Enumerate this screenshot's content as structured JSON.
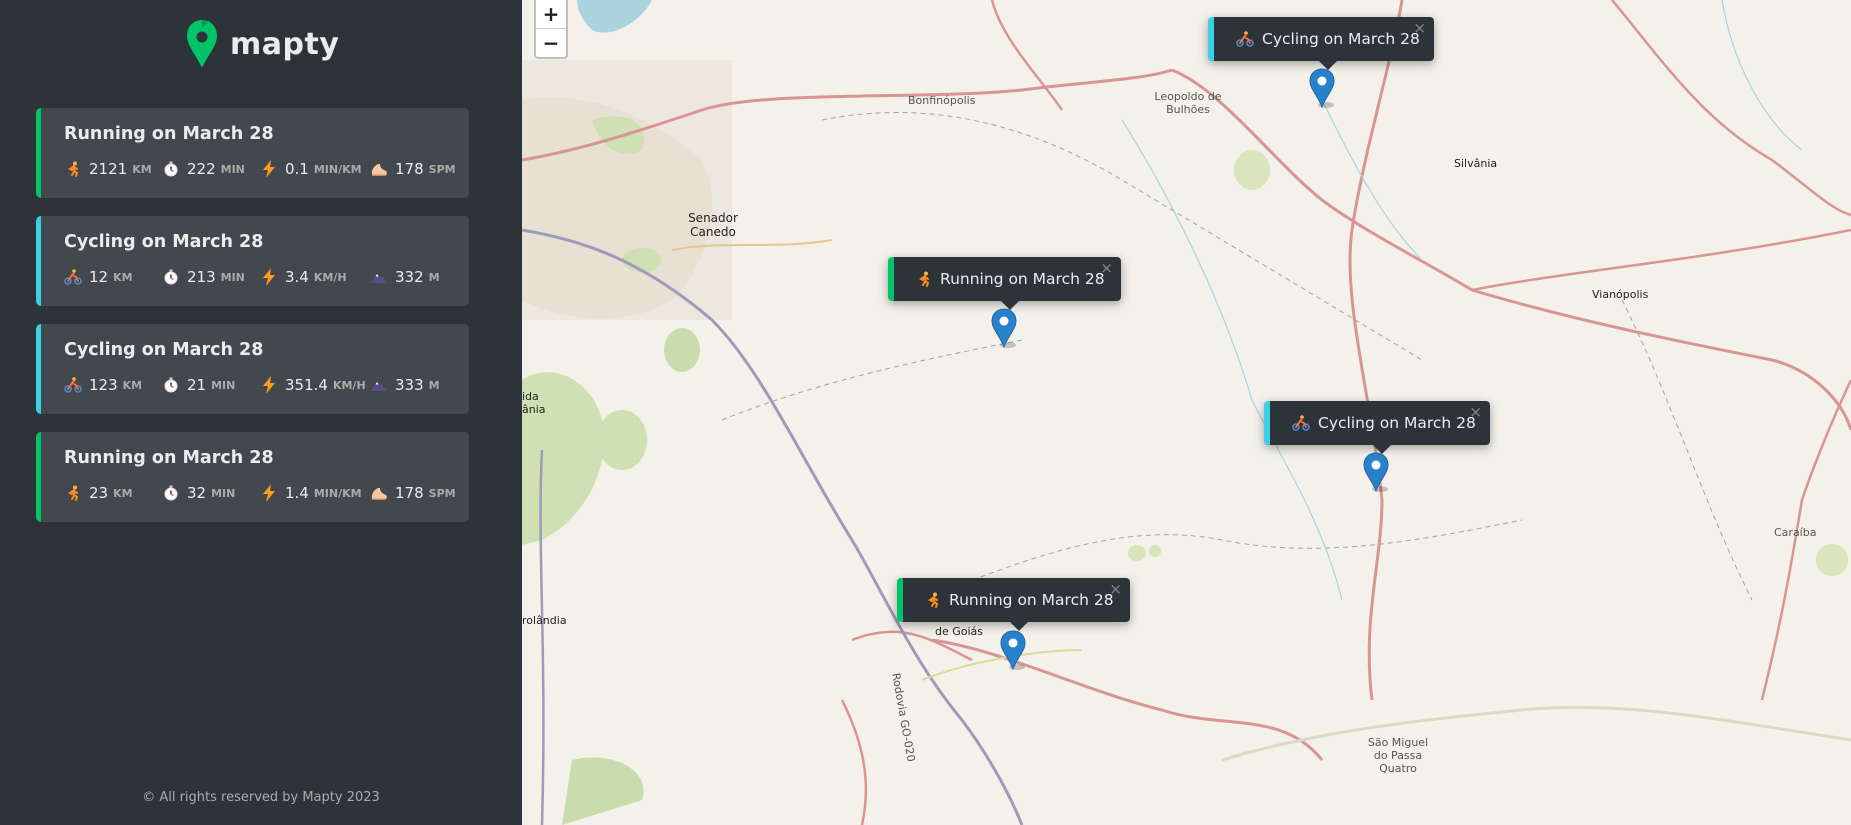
{
  "app": {
    "name": "mapty"
  },
  "footer": "© All rights reserved by Mapty 2023",
  "zoom": {
    "in": "+",
    "out": "−"
  },
  "workouts": [
    {
      "type": "running",
      "title": "Running on March 28",
      "distance": "2121",
      "distance_unit": "KM",
      "duration": "222",
      "duration_unit": "MIN",
      "speed": "0.1",
      "speed_unit": "MIN/KM",
      "extra": "178",
      "extra_unit": "SPM"
    },
    {
      "type": "cycling",
      "title": "Cycling on March 28",
      "distance": "12",
      "distance_unit": "KM",
      "duration": "213",
      "duration_unit": "MIN",
      "speed": "3.4",
      "speed_unit": "KM/H",
      "extra": "332",
      "extra_unit": "M"
    },
    {
      "type": "cycling",
      "title": "Cycling on March 28",
      "distance": "123",
      "distance_unit": "KM",
      "duration": "21",
      "duration_unit": "MIN",
      "speed": "351.4",
      "speed_unit": "KM/H",
      "extra": "333",
      "extra_unit": "M"
    },
    {
      "type": "running",
      "title": "Running on March 28",
      "distance": "23",
      "distance_unit": "KM",
      "duration": "32",
      "duration_unit": "MIN",
      "speed": "1.4",
      "speed_unit": "MIN/KM",
      "extra": "178",
      "extra_unit": "SPM"
    }
  ],
  "popups": [
    {
      "type": "cycling",
      "label": "Cycling on March 28",
      "close": "×"
    },
    {
      "type": "running",
      "label": "Running on March 28",
      "close": "×"
    },
    {
      "type": "cycling",
      "label": "Cycling on March 28",
      "close": "×"
    },
    {
      "type": "running",
      "label": "Running on March 28",
      "close": "×"
    }
  ],
  "map_labels": [
    "Bonfinópolis",
    "Leopoldo de Bulhões",
    "Silvânia",
    "Senador Canedo",
    "Vianópolis",
    "Caraíba",
    "de Goiás",
    "Rodovia GO-020",
    "São Miguel do Passa Quatro",
    "rolândia",
    "ida ânia"
  ],
  "colors": {
    "running": "#00c46a",
    "cycling": "#3ad1e6",
    "sidebar": "#2d3439",
    "card": "#42484d",
    "marker": "#2a81cb"
  },
  "icons": {
    "running": "running-person-icon",
    "cycling": "cyclist-icon",
    "duration": "stopwatch-icon",
    "speed": "lightning-icon",
    "cadence": "footprint-icon",
    "elevation": "mountain-icon"
  }
}
